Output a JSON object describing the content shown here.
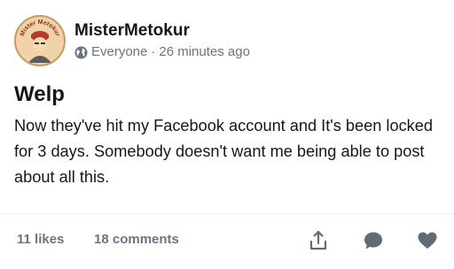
{
  "post": {
    "author": "MisterMetokur",
    "avatar_text": "Mister Metokur",
    "visibility_icon": "globe-icon",
    "visibility": "Everyone",
    "separator": "·",
    "timestamp": "26 minutes ago",
    "title": "Welp",
    "body": "Now they've hit my Facebook account and It's been locked for 3 days.  Somebody doesn't want me being able to post about all this."
  },
  "footer": {
    "likes": "11 likes",
    "comments": "18 comments",
    "actions": [
      "share-icon",
      "comment-icon",
      "heart-icon"
    ]
  },
  "colors": {
    "text": "#14171a",
    "muted": "#6b7580",
    "avatar_bg": "#e8c18e",
    "avatar_ring": "#c79a62"
  }
}
